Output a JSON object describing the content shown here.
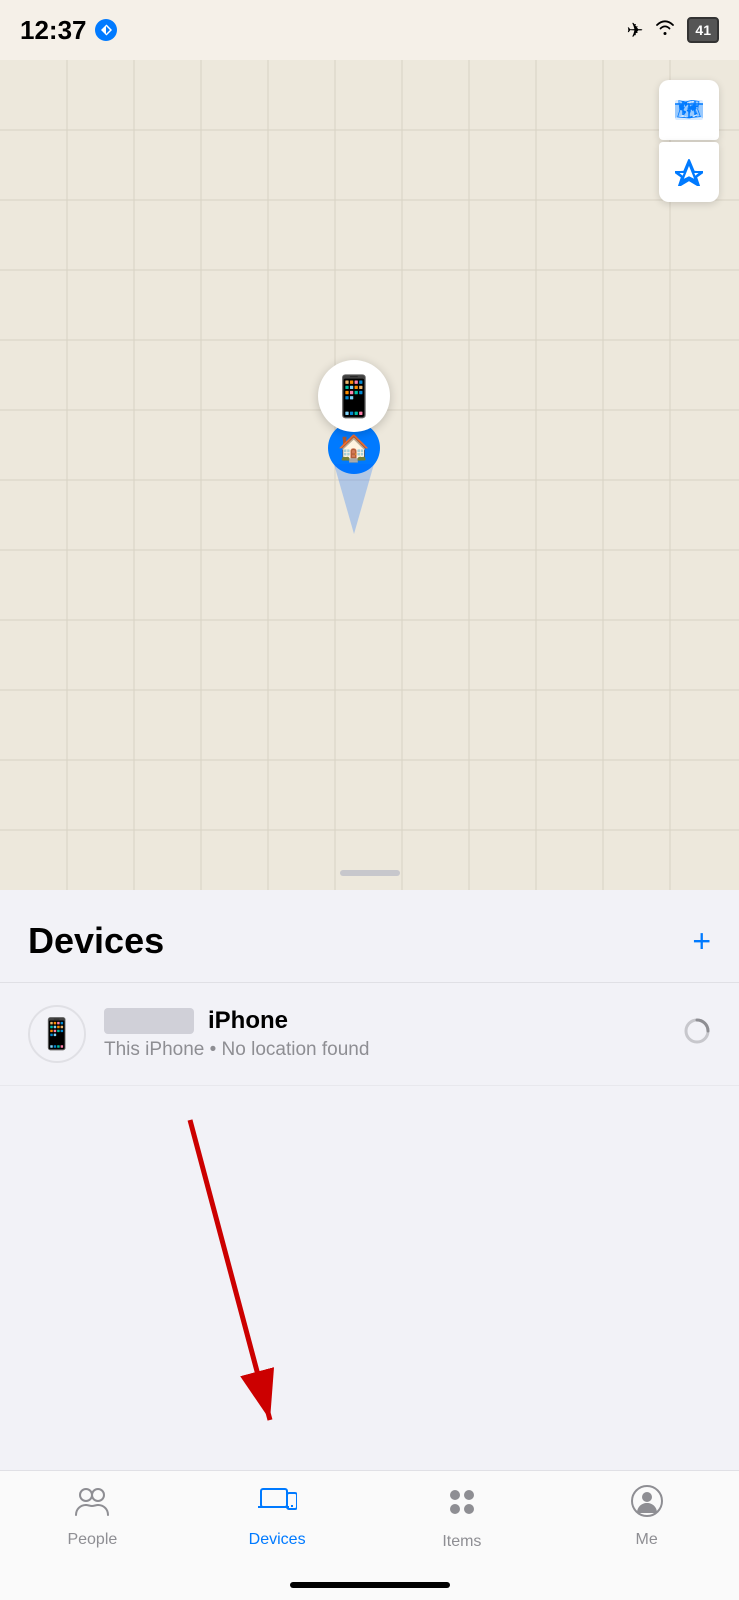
{
  "statusBar": {
    "time": "12:37",
    "battery": "41"
  },
  "mapButtons": {
    "mapLabel": "map",
    "locationLabel": "location"
  },
  "device": {
    "name": "iPhone",
    "subtitle": "This iPhone • No location found"
  },
  "panel": {
    "title": "Devices",
    "addLabel": "+"
  },
  "tabs": [
    {
      "id": "people",
      "label": "People",
      "icon": "👥",
      "active": false
    },
    {
      "id": "devices",
      "label": "Devices",
      "icon": "💻",
      "active": true
    },
    {
      "id": "items",
      "label": "Items",
      "icon": "⠿",
      "active": false
    },
    {
      "id": "me",
      "label": "Me",
      "icon": "👤",
      "active": false
    }
  ]
}
